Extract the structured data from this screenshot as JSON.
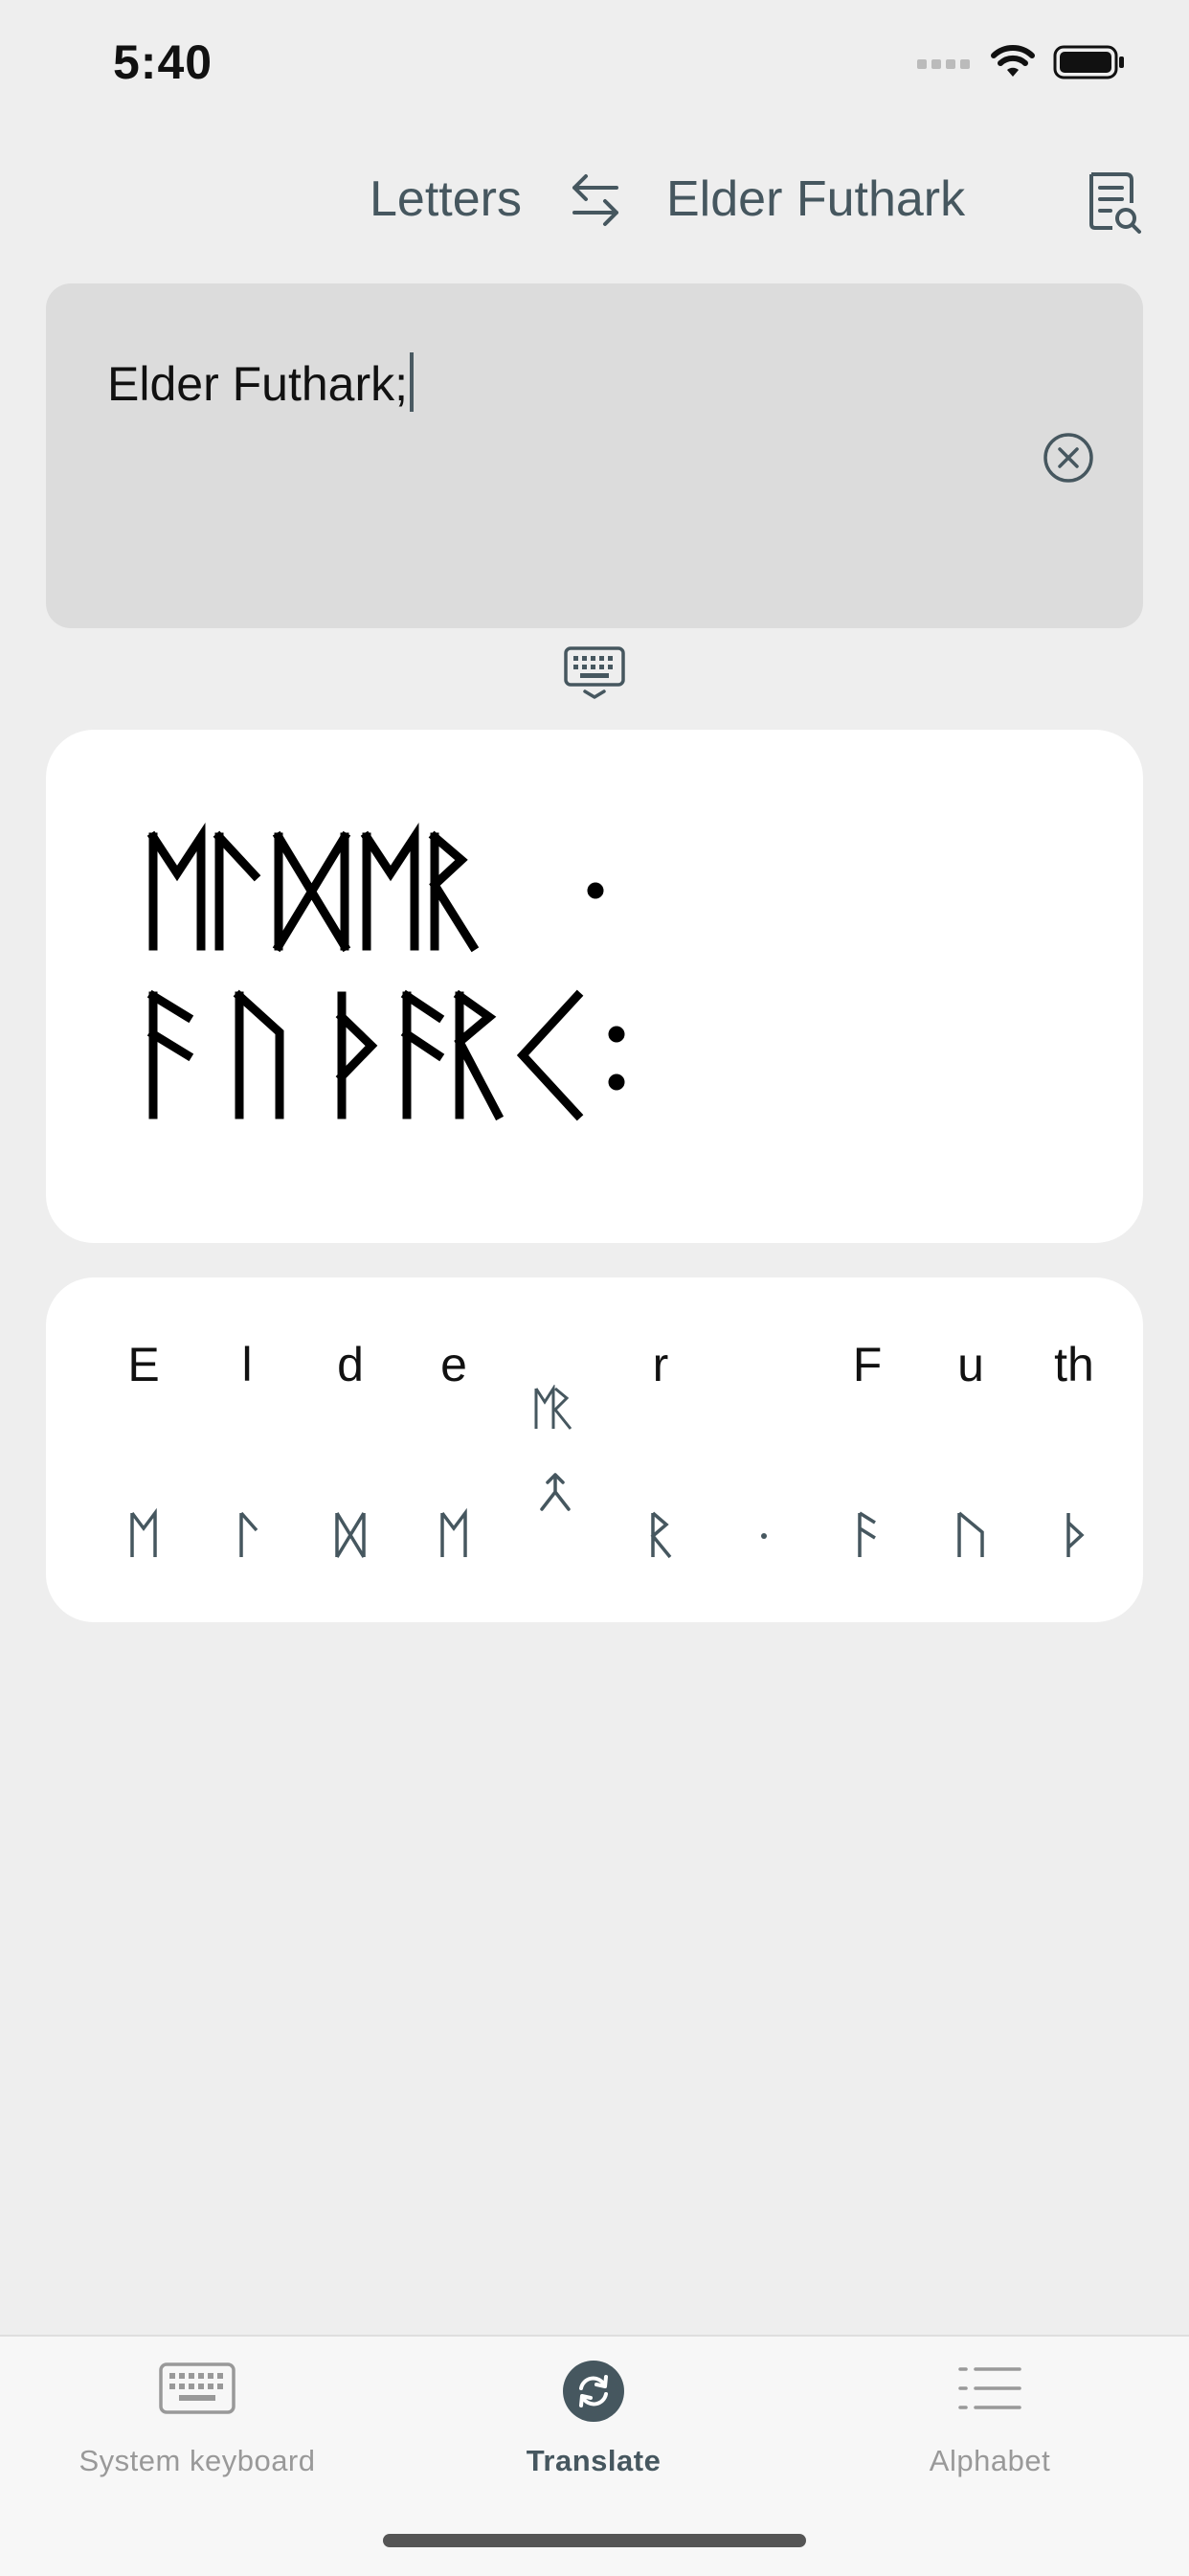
{
  "status_bar": {
    "time": "5:40"
  },
  "header": {
    "source_language": "Letters",
    "target_language": "Elder Futhark",
    "swap_icon": "swap-arrows-icon",
    "history_icon": "document-search-icon"
  },
  "input": {
    "value": "Elder Futhark;",
    "clear_icon": "clear-circle-icon"
  },
  "keyboard_toggle_icon": "keyboard-hide-icon",
  "output": {
    "line1": "ᛖᛚᛞᛖᚱ·",
    "line2": "ᚠᚢᚦᚨᚱᚲ:"
  },
  "transliteration": [
    {
      "latin": "E",
      "rune": "ᛖ"
    },
    {
      "latin": "l",
      "rune": "ᛚ"
    },
    {
      "latin": "d",
      "rune": "ᛞ"
    },
    {
      "latin": "e",
      "rune": "ᛖ"
    },
    {
      "latin": "",
      "rune": "ᛖᚱ",
      "ligature": true
    },
    {
      "latin": "r",
      "rune": "ᚱ"
    },
    {
      "latin": "",
      "rune": "·"
    },
    {
      "latin": "F",
      "rune": "ᚠ"
    },
    {
      "latin": "u",
      "rune": "ᚢ"
    },
    {
      "latin": "th",
      "rune": "ᚦ"
    }
  ],
  "tabs": [
    {
      "label": "System keyboard",
      "icon": "keyboard-icon",
      "active": false
    },
    {
      "label": "Translate",
      "icon": "translate-refresh-icon",
      "active": true
    },
    {
      "label": "Alphabet",
      "icon": "list-icon",
      "active": false
    }
  ],
  "colors": {
    "background": "#eeeeee",
    "input_card": "#dcdcdc",
    "card": "#ffffff",
    "accent": "#46575f"
  }
}
